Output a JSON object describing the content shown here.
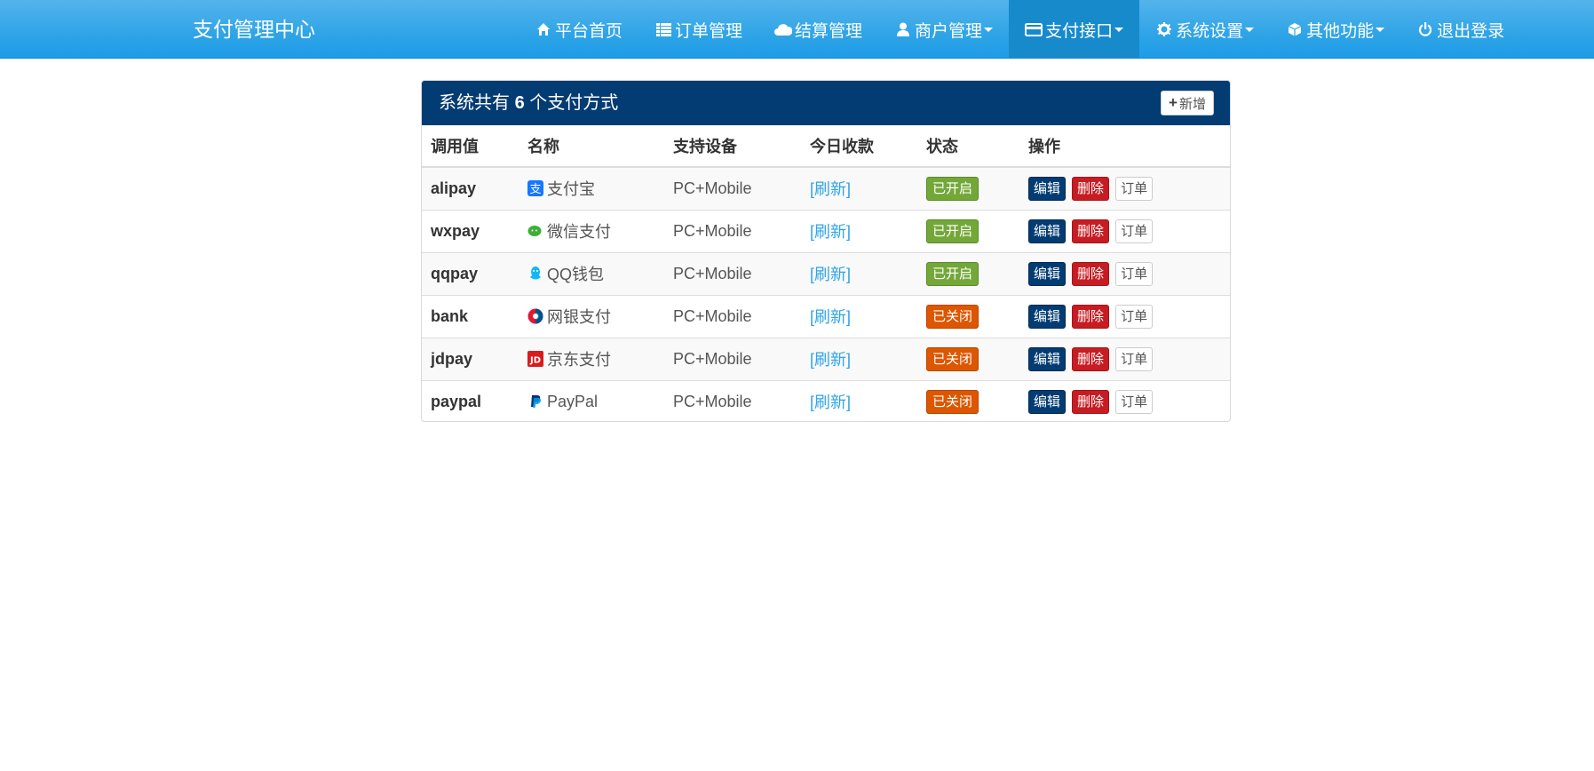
{
  "navbar": {
    "brand": "支付管理中心",
    "items": [
      {
        "label": "平台首页",
        "icon": "home-icon"
      },
      {
        "label": "订单管理",
        "icon": "list-icon"
      },
      {
        "label": "结算管理",
        "icon": "cloud-icon"
      },
      {
        "label": "商户管理",
        "icon": "user-icon"
      },
      {
        "label": "支付接口",
        "icon": "credit-card-icon"
      },
      {
        "label": "系统设置",
        "icon": "gear-icon"
      },
      {
        "label": "其他功能",
        "icon": "cube-icon"
      },
      {
        "label": "退出登录",
        "icon": "power-icon"
      }
    ],
    "active_item": "支付接口"
  },
  "panel": {
    "title_prefix": "系统共有",
    "count": "6",
    "title_suffix": "个支付方式",
    "add_label": "新增"
  },
  "table": {
    "headers": [
      "调用值",
      "名称",
      "支持设备",
      "今日收款",
      "状态",
      "操作"
    ],
    "rows": [
      {
        "code": "alipay",
        "name": "支付宝",
        "icon": "alipay-icon",
        "device": "PC+Mobile",
        "today": "[刷新]",
        "status": "已开启"
      },
      {
        "code": "wxpay",
        "name": "微信支付",
        "icon": "wechat-icon",
        "device": "PC+Mobile",
        "today": "[刷新]",
        "status": "已开启"
      },
      {
        "code": "qqpay",
        "name": "QQ钱包",
        "icon": "qq-icon",
        "device": "PC+Mobile",
        "today": "[刷新]",
        "status": "已开启"
      },
      {
        "code": "bank",
        "name": "网银支付",
        "icon": "unionpay-icon",
        "device": "PC+Mobile",
        "today": "[刷新]",
        "status": "已关闭"
      },
      {
        "code": "jdpay",
        "name": "京东支付",
        "icon": "jd-icon",
        "device": "PC+Mobile",
        "today": "[刷新]",
        "status": "已关闭"
      },
      {
        "code": "paypal",
        "name": "PayPal",
        "icon": "paypal-icon",
        "device": "PC+Mobile",
        "today": "[刷新]",
        "status": "已关闭"
      }
    ],
    "actions": {
      "edit": "编辑",
      "delete": "删除",
      "orders": "订单"
    }
  },
  "colors": {
    "navbar": "#2fa4e7",
    "nav_active": "#178acc",
    "panel_heading": "#033c73",
    "status_on": "#73a839",
    "status_off": "#dd5600",
    "edit": "#033c73",
    "delete": "#c71c22",
    "link": "#2fa4e7"
  }
}
